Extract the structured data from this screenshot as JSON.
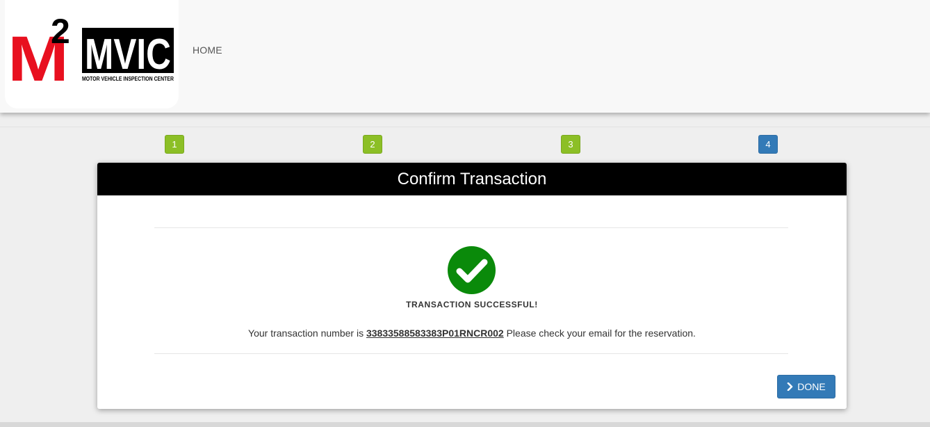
{
  "header": {
    "logo": {
      "mark": "M",
      "superscript": "2",
      "wordmark": "MVIC",
      "tagline": "MOTOR VEHICLE INSPECTION CENTER",
      "colors": {
        "red": "#e8101f",
        "black": "#000000"
      }
    },
    "nav": {
      "home_label": "HOME"
    }
  },
  "steps": [
    {
      "label": "1",
      "status": "completed"
    },
    {
      "label": "2",
      "status": "completed"
    },
    {
      "label": "3",
      "status": "completed"
    },
    {
      "label": "4",
      "status": "active"
    }
  ],
  "confirm": {
    "title": "Confirm Transaction",
    "status_icon": "check-circle-icon",
    "success_title": "TRANSACTION SUCCESSFUL!",
    "message_prefix": "Your transaction number is",
    "transaction_number": "33833588583383P01RNCR002",
    "message_suffix": "Please check your email for the reservation.",
    "done_icon": "chevron-right-icon",
    "done_label": "DONE"
  },
  "colors": {
    "step_completed": "#8cbf26",
    "step_active": "#337ab7",
    "success_green": "#0a8a0a",
    "header_bg": "#000000",
    "button_primary": "#337ab7"
  }
}
